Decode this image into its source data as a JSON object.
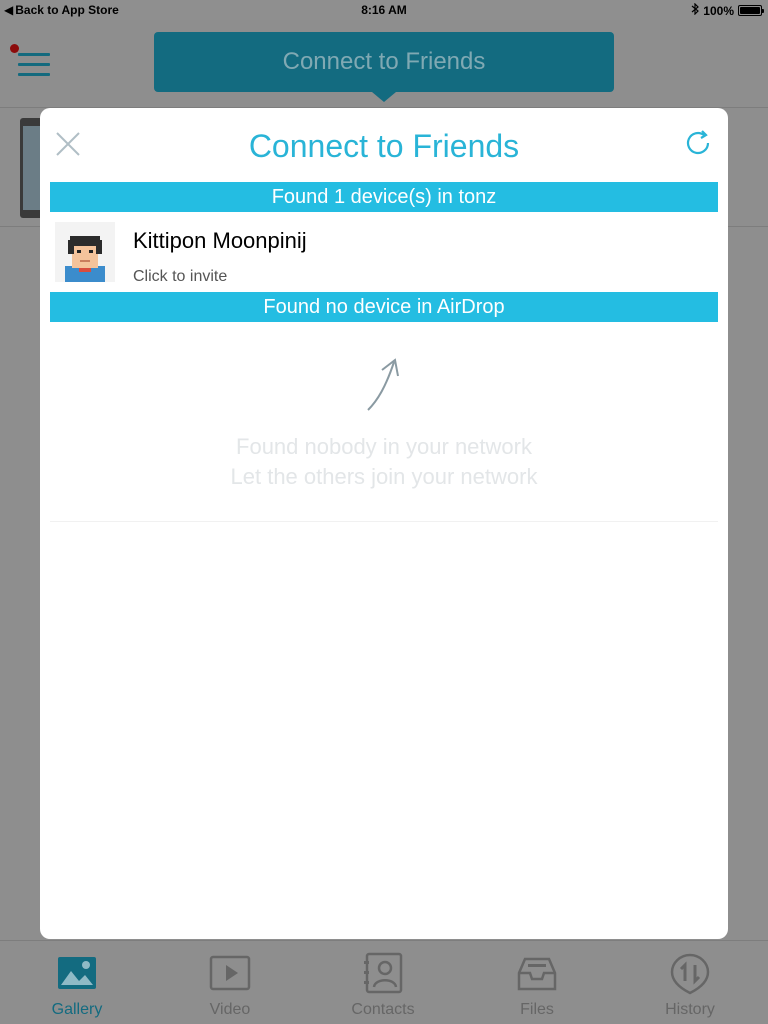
{
  "status_bar": {
    "back_label": "Back to App Store",
    "time": "8:16 AM",
    "battery_text": "100%",
    "battery_level": 1.0
  },
  "header": {
    "title": "Connect to Friends"
  },
  "modal": {
    "title": "Connect to Friends",
    "sections": [
      {
        "label": "Found 1 device(s) in tonz",
        "devices": [
          {
            "name": "Kittipon Moonpinij",
            "subtitle": "Click to invite"
          }
        ]
      },
      {
        "label": "Found no device in AirDrop",
        "devices": []
      }
    ],
    "empty_state": {
      "line1": "Found nobody in your network",
      "line2": "Let the others join your network"
    }
  },
  "tab_bar": {
    "tabs": [
      {
        "label": "Gallery",
        "icon": "gallery-icon",
        "active": true
      },
      {
        "label": "Video",
        "icon": "video-icon",
        "active": false
      },
      {
        "label": "Contacts",
        "icon": "contacts-icon",
        "active": false
      },
      {
        "label": "Files",
        "icon": "files-icon",
        "active": false
      },
      {
        "label": "History",
        "icon": "history-icon",
        "active": false
      }
    ]
  },
  "colors": {
    "accent": "#24bde2",
    "title": "#29b4d7",
    "overlay": "#8e8e8e",
    "header_pill": "#136b80"
  }
}
